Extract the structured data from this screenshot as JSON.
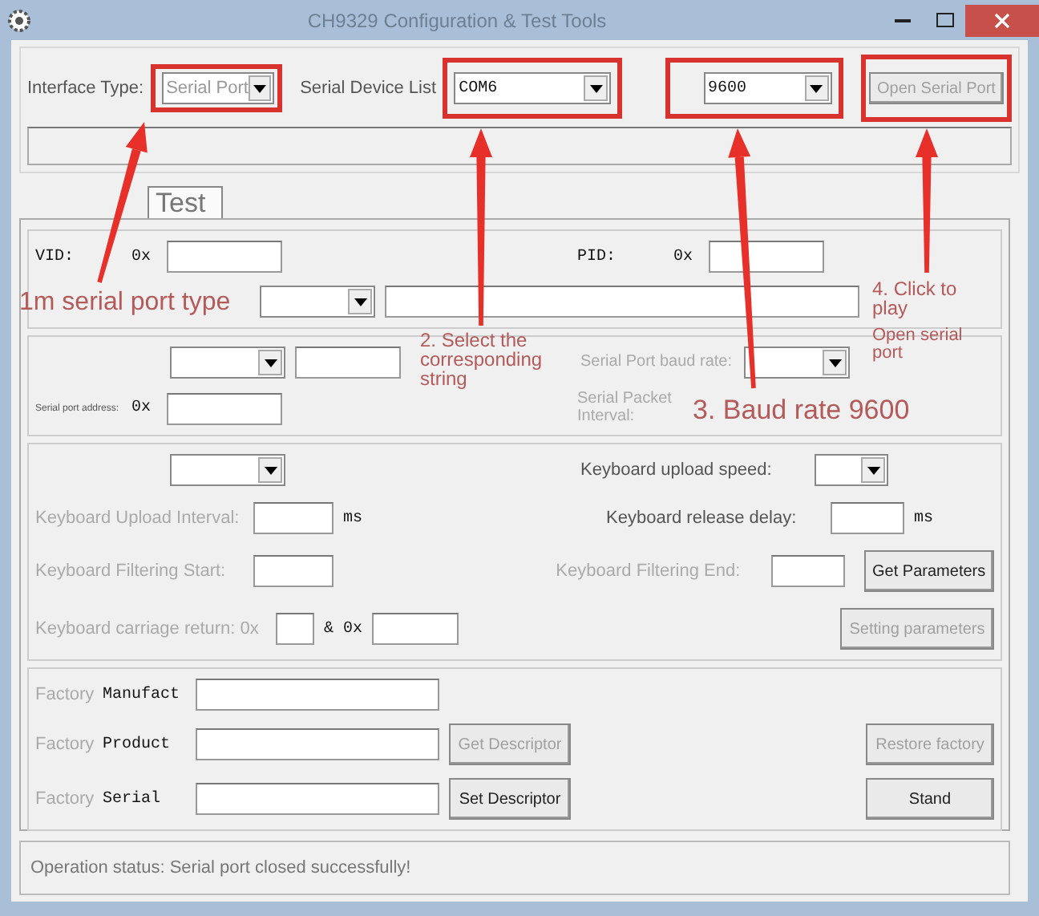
{
  "window": {
    "title": "CH9329 Configuration & Test Tools"
  },
  "connection": {
    "interface_label": "Interface Type:",
    "interface": {
      "value": "Serial Port",
      "disabled": true
    },
    "device_label": "Serial Device List",
    "device": {
      "value": "COM6"
    },
    "baud": {
      "value": "9600"
    },
    "open_button": {
      "label": "Open Serial Port",
      "disabled": true
    }
  },
  "tabs": [
    {
      "label": "Test",
      "selected": true
    }
  ],
  "usb": {
    "vid_label": "VID:",
    "vid_prefix": "0x",
    "pid_label": "PID:",
    "pid_prefix": "0x"
  },
  "serial": {
    "baud_label": {
      "text": "Serial Port baud rate:",
      "disabled": true
    },
    "address_label": "Serial port address:",
    "address_prefix": "0x",
    "interval_label": {
      "text": "Serial Packet Interval:",
      "disabled": true
    }
  },
  "keyboard": {
    "upload_speed_label": {
      "text": "Keyboard upload speed:",
      "disabled": false
    },
    "upload_interval_label": {
      "text": "Keyboard Upload Interval:",
      "disabled": true
    },
    "upload_interval_unit": "ms",
    "release_delay_label": {
      "text": "Keyboard release delay:",
      "disabled": false
    },
    "release_delay_unit": "ms",
    "filter_start_label": {
      "text": "Keyboard Filtering Start:",
      "disabled": true
    },
    "filter_end_label": {
      "text": "Keyboard Filtering End:",
      "disabled": true
    },
    "cr_label": {
      "text": "Keyboard carriage return: 0x",
      "disabled": true
    },
    "cr_join": "&",
    "cr_prefix": "0x"
  },
  "parameter_buttons": [
    {
      "label": "Get Parameters",
      "disabled": false
    },
    {
      "label": "Setting parameters",
      "disabled": true
    }
  ],
  "descriptors": [
    {
      "prefix": "Factory",
      "label": "Manufact"
    },
    {
      "prefix": "Factory",
      "label": "Product"
    },
    {
      "prefix": "Factory",
      "label": "Serial"
    }
  ],
  "descriptor_buttons": [
    {
      "label": "Get Descriptor",
      "disabled": true
    },
    {
      "label": "Set Descriptor",
      "disabled": false
    }
  ],
  "factory_buttons": [
    {
      "label": "Restore factory",
      "disabled": true
    },
    {
      "label": "Stand",
      "disabled": false
    }
  ],
  "status": "Operation status: Serial port closed successfully!",
  "annotations": [
    {
      "text": "1m serial port type"
    },
    {
      "text": "2. Select the corresponding string"
    },
    {
      "text": "3. Baud rate 9600"
    },
    {
      "text": "4. Click to play"
    },
    {
      "text": "Open serial port"
    }
  ]
}
